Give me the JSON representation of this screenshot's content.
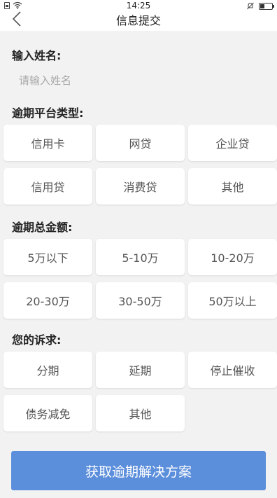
{
  "status_bar": {
    "time": "14:25"
  },
  "header": {
    "title": "信息提交"
  },
  "name_section": {
    "label": "输入姓名:",
    "placeholder": "请输入姓名",
    "value": ""
  },
  "platform_section": {
    "label": "逾期平台类型:",
    "options": [
      "信用卡",
      "网贷",
      "企业贷",
      "信用贷",
      "消费贷",
      "其他"
    ]
  },
  "amount_section": {
    "label": "逾期总金额:",
    "options": [
      "5万以下",
      "5-10万",
      "10-20万",
      "20-30万",
      "30-50万",
      "50万以上"
    ]
  },
  "request_section": {
    "label": "您的诉求:",
    "options": [
      "分期",
      "延期",
      "停止催收",
      "债务减免",
      "其他"
    ]
  },
  "submit": {
    "label": "获取逾期解决方案"
  },
  "colors": {
    "background": "#f2f2f2",
    "card": "#ffffff",
    "primary_button": "#5b8edb"
  }
}
